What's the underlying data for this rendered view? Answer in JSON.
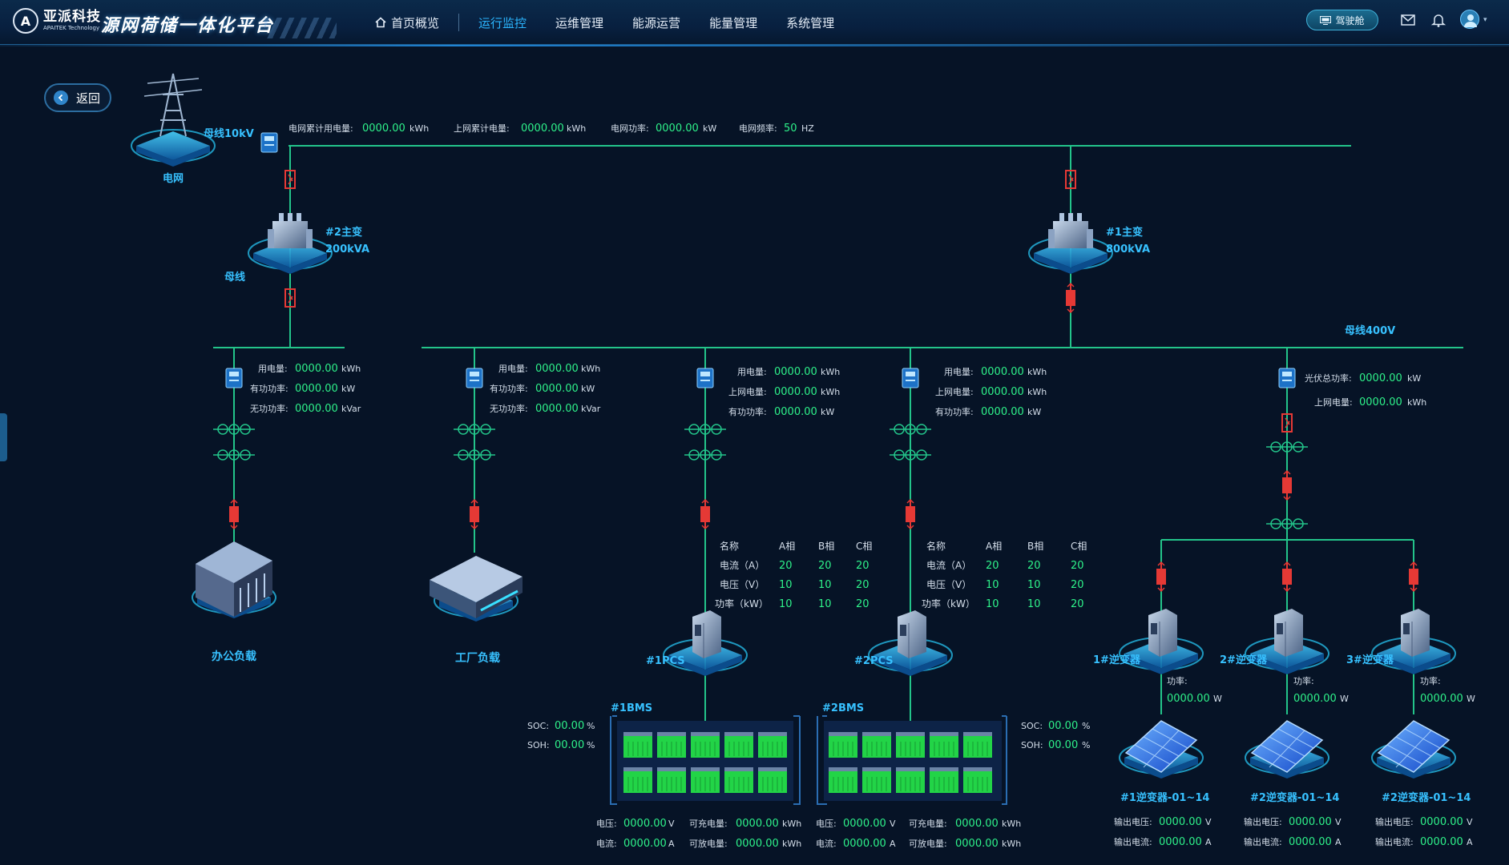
{
  "brand": {
    "name_cn": "亚派科技",
    "name_en": "APAITEK Technology",
    "app_title": "源网荷储一体化平台"
  },
  "nav": [
    {
      "label": "首页概览",
      "active": false,
      "icon": "home-icon"
    },
    {
      "label": "运行监控",
      "active": true
    },
    {
      "label": "运维管理",
      "active": false
    },
    {
      "label": "能源运营",
      "active": false
    },
    {
      "label": "能量管理",
      "active": false
    },
    {
      "label": "系统管理",
      "active": false
    }
  ],
  "header_right": {
    "cockpit_label": "驾驶舱",
    "icons": [
      "mail-icon",
      "bell-icon",
      "user-avatar-icon"
    ]
  },
  "back_label": "返回",
  "colors": {
    "line": "#23c48a",
    "switch": "#e53935",
    "value": "#2ef28a",
    "label": "#37c1ff",
    "accent": "#2bb6ff"
  },
  "grid": {
    "name": "电网",
    "bus_label": "母线10kV",
    "stats": [
      {
        "key": "电网累计用电量:",
        "value": "0000.00",
        "unit": "kWh"
      },
      {
        "key": "上网累计电量:",
        "value": "0000.00",
        "unit": "kWh"
      },
      {
        "key": "电网功率:",
        "value": "0000.00",
        "unit": "kW"
      },
      {
        "key": "电网频率:",
        "value": "50",
        "unit": "HZ"
      }
    ]
  },
  "transformers": {
    "t2": {
      "name": "#2主变",
      "capacity": "200kVA"
    },
    "t1": {
      "name": "#1主变",
      "capacity": "800kVA"
    },
    "bus_label": "母线",
    "bus400_label": "母线400V"
  },
  "loads": {
    "office": {
      "name": "办公负载",
      "stats": [
        {
          "key": "用电量:",
          "value": "0000.00",
          "unit": "kWh"
        },
        {
          "key": "有功功率:",
          "value": "0000.00",
          "unit": "kW"
        },
        {
          "key": "无功功率:",
          "value": "0000.00",
          "unit": "kVar"
        }
      ]
    },
    "factory": {
      "name": "工厂负载",
      "stats": [
        {
          "key": "用电量:",
          "value": "0000.00",
          "unit": "kWh"
        },
        {
          "key": "有功功率:",
          "value": "0000.00",
          "unit": "kW"
        },
        {
          "key": "无功功率:",
          "value": "0000.00",
          "unit": "kVar"
        }
      ]
    }
  },
  "storage": [
    {
      "pcs": "#1PCS",
      "bms": "#1BMS",
      "stats": [
        {
          "key": "用电量:",
          "value": "0000.00",
          "unit": "kWh"
        },
        {
          "key": "上网电量:",
          "value": "0000.00",
          "unit": "kWh"
        },
        {
          "key": "有功功率:",
          "value": "0000.00",
          "unit": "kW"
        }
      ],
      "table": {
        "headers": [
          "名称",
          "A相",
          "B相",
          "C相"
        ],
        "rows": [
          [
            "电流（A）",
            "20",
            "20",
            "20"
          ],
          [
            "电压（V）",
            "10",
            "10",
            "20"
          ],
          [
            "功率（kW）",
            "10",
            "10",
            "20"
          ]
        ]
      },
      "soc": {
        "key": "SOC:",
        "value": "00.00",
        "unit": "%"
      },
      "soh": {
        "key": "SOH:",
        "value": "00.00",
        "unit": "%"
      },
      "bottom": [
        {
          "key": "电压:",
          "value": "0000.00",
          "unit": "V"
        },
        {
          "key": "可充电量:",
          "value": "0000.00",
          "unit": "kWh"
        },
        {
          "key": "电流:",
          "value": "0000.00",
          "unit": "A"
        },
        {
          "key": "可放电量:",
          "value": "0000.00",
          "unit": "kWh"
        }
      ]
    },
    {
      "pcs": "#2PCS",
      "bms": "#2BMS",
      "stats": [
        {
          "key": "用电量:",
          "value": "0000.00",
          "unit": "kWh"
        },
        {
          "key": "上网电量:",
          "value": "0000.00",
          "unit": "kWh"
        },
        {
          "key": "有功功率:",
          "value": "0000.00",
          "unit": "kW"
        }
      ],
      "table": {
        "headers": [
          "名称",
          "A相",
          "B相",
          "C相"
        ],
        "rows": [
          [
            "电流（A）",
            "20",
            "20",
            "20"
          ],
          [
            "电压（V）",
            "10",
            "10",
            "20"
          ],
          [
            "功率（kW）",
            "10",
            "10",
            "20"
          ]
        ]
      },
      "soc": {
        "key": "SOC:",
        "value": "00.00",
        "unit": "%"
      },
      "soh": {
        "key": "SOH:",
        "value": "00.00",
        "unit": "%"
      },
      "bottom": [
        {
          "key": "电压:",
          "value": "0000.00",
          "unit": "V"
        },
        {
          "key": "可充电量:",
          "value": "0000.00",
          "unit": "kWh"
        },
        {
          "key": "电流:",
          "value": "0000.00",
          "unit": "A"
        },
        {
          "key": "可放电量:",
          "value": "0000.00",
          "unit": "kWh"
        }
      ]
    }
  ],
  "pv": {
    "stats": [
      {
        "key": "光伏总功率:",
        "value": "0000.00",
        "unit": "kW"
      },
      {
        "key": "上网电量:",
        "value": "0000.00",
        "unit": "kWh"
      }
    ],
    "inverters": [
      {
        "name": "1#逆变器",
        "power_key": "功率:",
        "power": "0000.00",
        "power_unit": "W",
        "array": "#1逆变器-01~14",
        "outputs": [
          {
            "key": "输出电压:",
            "value": "0000.00",
            "unit": "V"
          },
          {
            "key": "输出电流:",
            "value": "0000.00",
            "unit": "A"
          }
        ]
      },
      {
        "name": "2#逆变器",
        "power_key": "功率:",
        "power": "0000.00",
        "power_unit": "W",
        "array": "#2逆变器-01~14",
        "outputs": [
          {
            "key": "输出电压:",
            "value": "0000.00",
            "unit": "V"
          },
          {
            "key": "输出电流:",
            "value": "0000.00",
            "unit": "A"
          }
        ]
      },
      {
        "name": "3#逆变器",
        "power_key": "功率:",
        "power": "0000.00",
        "power_unit": "W",
        "array": "#2逆变器-01~14",
        "outputs": [
          {
            "key": "输出电压:",
            "value": "0000.00",
            "unit": "V"
          },
          {
            "key": "输出电流:",
            "value": "0000.00",
            "unit": "A"
          }
        ]
      }
    ]
  }
}
